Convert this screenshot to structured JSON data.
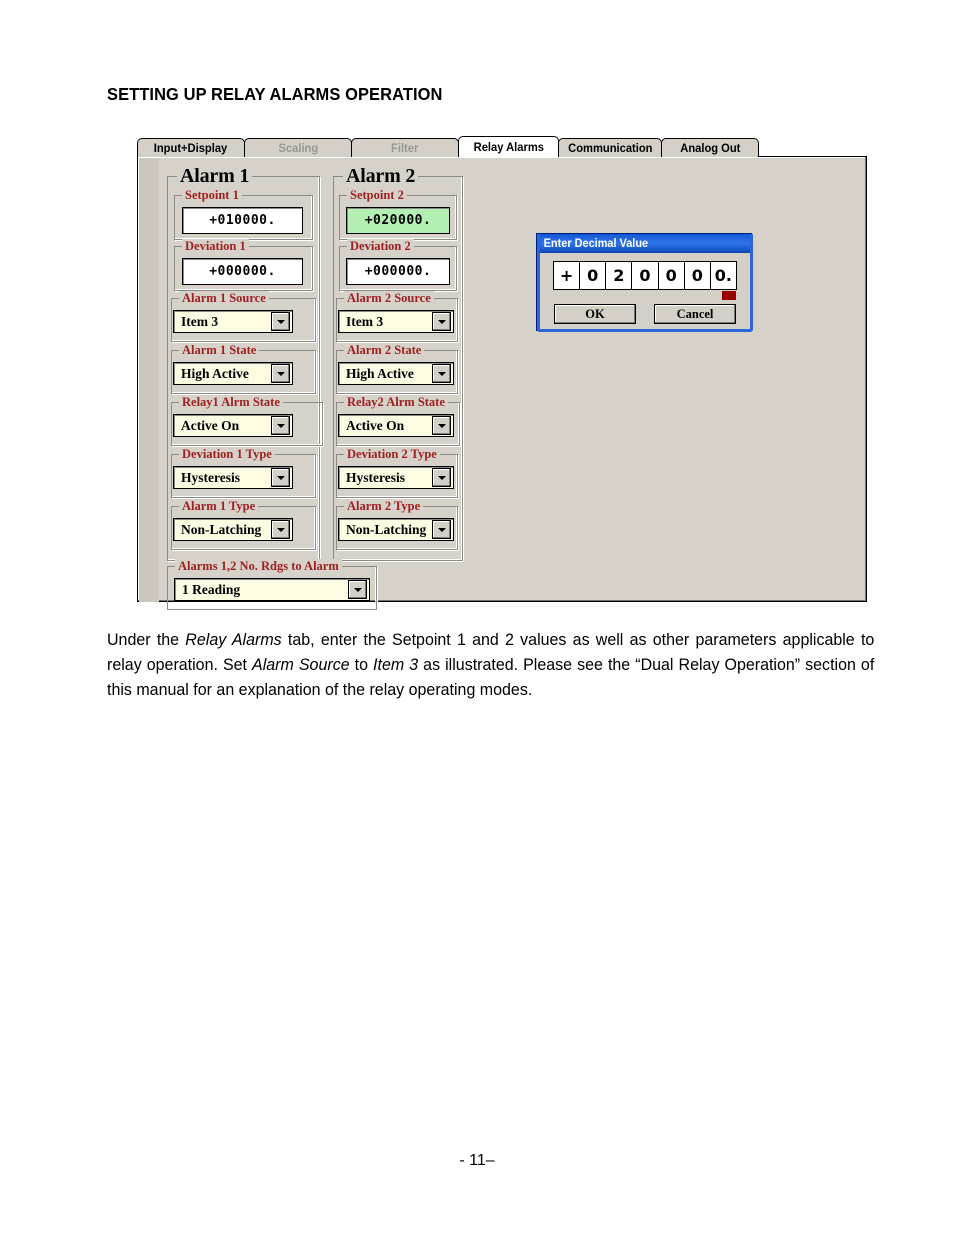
{
  "heading": "SETTING UP RELAY ALARMS OPERATION",
  "tabs": [
    {
      "label": "Input+Display",
      "state": "enabled"
    },
    {
      "label": "Scaling",
      "state": "disabled"
    },
    {
      "label": "Filter",
      "state": "disabled"
    },
    {
      "label": "Relay Alarms",
      "state": "active"
    },
    {
      "label": "Communication",
      "state": "enabled"
    },
    {
      "label": "Analog Out",
      "state": "enabled"
    }
  ],
  "alarm1": {
    "title": "Alarm 1",
    "setpoint": {
      "label": "Setpoint 1",
      "value": "+010000."
    },
    "deviation": {
      "label": "Deviation 1",
      "value": "+000000."
    },
    "source": {
      "label": "Alarm 1 Source",
      "value": "Item 3"
    },
    "state": {
      "label": "Alarm 1 State",
      "value": "High Active"
    },
    "relay_state": {
      "label": "Relay1 Alrm State",
      "value": "Active On"
    },
    "deviation_type": {
      "label": "Deviation 1 Type",
      "value": "Hysteresis"
    },
    "alarm_type": {
      "label": "Alarm 1 Type",
      "value": "Non-Latching"
    }
  },
  "alarm2": {
    "title": "Alarm 2",
    "setpoint": {
      "label": "Setpoint 2",
      "value": "+020000.",
      "highlight": "#b4f0b4"
    },
    "deviation": {
      "label": "Deviation 2",
      "value": "+000000."
    },
    "source": {
      "label": "Alarm 2 Source",
      "value": "Item 3"
    },
    "state": {
      "label": "Alarm 2 State",
      "value": "High Active"
    },
    "relay_state": {
      "label": "Relay2 Alrm State",
      "value": "Active On"
    },
    "deviation_type": {
      "label": "Deviation 2 Type",
      "value": "Hysteresis"
    },
    "alarm_type": {
      "label": "Alarm 2 Type",
      "value": "Non-Latching"
    }
  },
  "readings": {
    "label": "Alarms 1,2  No. Rdgs to Alarm",
    "value": "1 Reading"
  },
  "dialog": {
    "title": "Enter Decimal Value",
    "digits": [
      "+",
      "0",
      "2",
      "0",
      "0",
      "0",
      "0."
    ],
    "ok_label": "OK",
    "cancel_label": "Cancel",
    "titlebar_color": "#2f74e8",
    "marker_color": "#990000"
  },
  "paragraph": {
    "line1_a": "Under  the  ",
    "line1_i": "Relay Alarms",
    "line1_b": "  tab,  enter  the  Setpoint  1  and  2  values  as  well  as  other  parameters",
    "line2_a": "applicable to relay operation. Set ",
    "line2_i1": "Alarm Source",
    "line2_b": " to ",
    "line2_i2": "Item 3",
    "line2_c": " as illustrated. Please see the “Dual Relay",
    "line3": "Operation” section of this manual for an explanation of the relay operating modes."
  },
  "page_number": "- 11–"
}
